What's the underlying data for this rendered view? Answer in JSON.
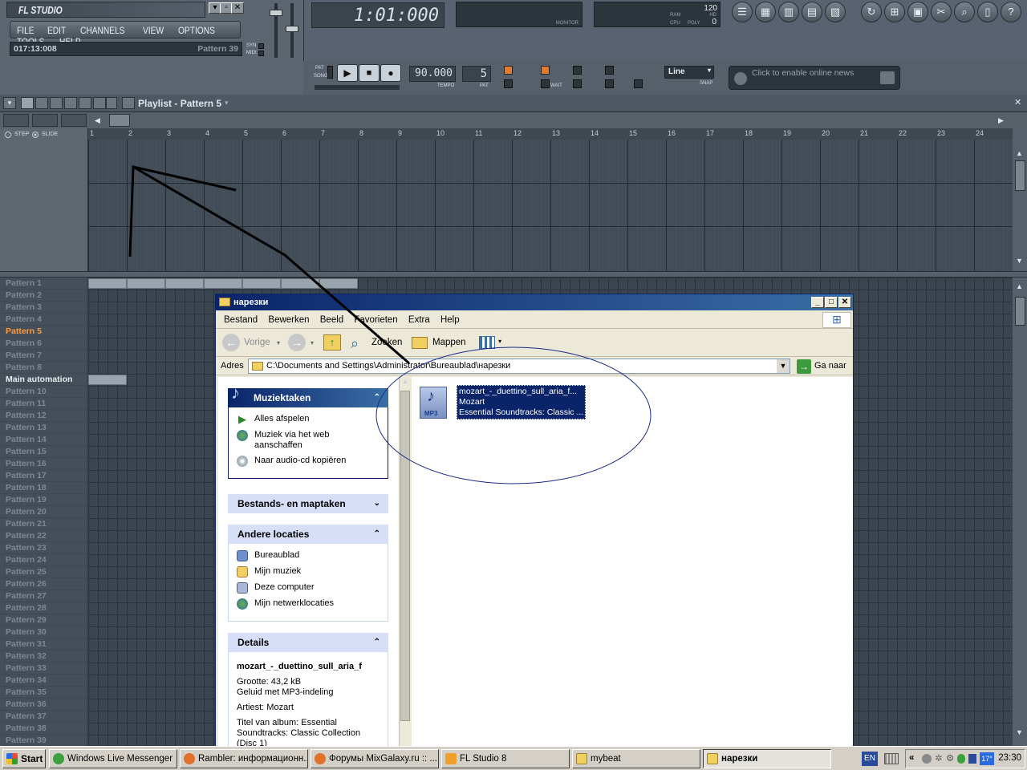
{
  "fl": {
    "logo": "FL STUDIO",
    "menu": [
      "FILE",
      "EDIT",
      "CHANNELS",
      "VIEW",
      "OPTIONS",
      "TOOLS",
      "HELP"
    ],
    "hint_time": "017:13:008",
    "hint_pattern": "Pattern 39",
    "syn": "SYN",
    "midi": "MIDI",
    "song_time": "1:01:000",
    "monitor": "MONITOR",
    "ram": "RAM",
    "cpu": "CPU",
    "poly": "POLY",
    "poly_value": "0",
    "num_120": "120",
    "hd": "HD",
    "pat_label": "PAT",
    "song_label": "SONG",
    "tempo": "90.000",
    "tempo_label": "TEMPO",
    "pattern_num": "5",
    "pattern_num_label": "PAT",
    "snap_mode": "Line",
    "snap_label": "SNAP",
    "wait_label": "WAIT",
    "news": "Click to enable online news",
    "playlist_title": "Playlist - Pattern 5",
    "step_label": "STEP",
    "slide_label": "SLIDE",
    "ruler": [
      "1",
      "2",
      "3",
      "4",
      "5",
      "6",
      "7",
      "8",
      "9",
      "10",
      "11",
      "12",
      "13",
      "14",
      "15",
      "16",
      "17",
      "18",
      "19",
      "20",
      "21",
      "22",
      "23",
      "24"
    ],
    "patterns": [
      "Pattern 1",
      "Pattern 2",
      "Pattern 3",
      "Pattern 4",
      "Pattern 5",
      "Pattern 6",
      "Pattern 7",
      "Pattern 8",
      "Main automation",
      "Pattern 10",
      "Pattern 11",
      "Pattern 12",
      "Pattern 13",
      "Pattern 14",
      "Pattern 15",
      "Pattern 16",
      "Pattern 17",
      "Pattern 18",
      "Pattern 19",
      "Pattern 20",
      "Pattern 21",
      "Pattern 22",
      "Pattern 23",
      "Pattern 24",
      "Pattern 25",
      "Pattern 26",
      "Pattern 27",
      "Pattern 28",
      "Pattern 29",
      "Pattern 30",
      "Pattern 31",
      "Pattern 32",
      "Pattern 33",
      "Pattern 34",
      "Pattern 35",
      "Pattern 36",
      "Pattern 37",
      "Pattern 38",
      "Pattern 39"
    ],
    "active_pattern_index": 4,
    "automation_index": 8
  },
  "explorer": {
    "title": "нарезки",
    "menu": [
      "Bestand",
      "Bewerken",
      "Beeld",
      "Favorieten",
      "Extra",
      "Help"
    ],
    "back": "Vorige",
    "search": "Zoeken",
    "folders": "Mappen",
    "address_label": "Adres",
    "address": "C:\\Documents and Settings\\Administrator\\Bureaublad\\нарезки",
    "go": "Ga naar",
    "panels": {
      "music": {
        "title": "Muziektaken",
        "items": [
          "Alles afspelen",
          "Muziek via het web aanschaffen",
          "Naar audio-cd kopiëren"
        ]
      },
      "file_tasks": {
        "title": "Bestands- en maptaken"
      },
      "other": {
        "title": "Andere locaties",
        "items": [
          "Bureaublad",
          "Mijn muziek",
          "Deze computer",
          "Mijn netwerklocaties"
        ]
      },
      "details": {
        "title": "Details",
        "name": "mozart_-_duettino_sull_aria_f",
        "size": "Grootte: 43,2 kB",
        "type": "Geluid met MP3-indeling",
        "artist": "Artiest:  Mozart",
        "album": "Titel van album: Essential Soundtracks: Classic Collection (Disc 1)"
      }
    },
    "file": {
      "icon_label": "MP3",
      "name": "mozart_-_duettino_sull_aria_f...",
      "artist": "Mozart",
      "album": "Essential Soundtracks: Classic ..."
    }
  },
  "taskbar": {
    "start": "Start",
    "items": [
      "Windows Live Messenger",
      "Rambler: информационн...",
      "Форумы MixGalaxy.ru :: ...",
      "FL Studio 8",
      "mybeat",
      "нарезки"
    ],
    "lang": "EN",
    "temp": "17°",
    "clock": "23:30"
  }
}
